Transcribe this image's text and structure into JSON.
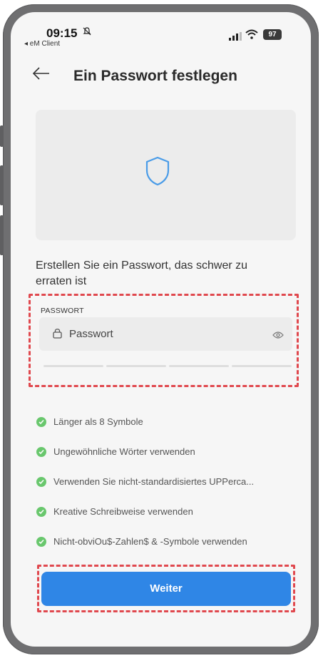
{
  "status_bar": {
    "time": "09:15",
    "back_to_app": "◂ eM Client",
    "battery": "97"
  },
  "header": {
    "title": "Ein Passwort festlegen"
  },
  "intro": {
    "text": "Erstellen Sie ein Passwort, das schwer zu erraten ist"
  },
  "password": {
    "label": "PASSWORT",
    "placeholder": "Passwort"
  },
  "requirements": [
    {
      "text": "Länger als 8 Symbole"
    },
    {
      "text": "Ungewöhnliche Wörter verwenden"
    },
    {
      "text": "Verwenden Sie nicht-standardisiertes UPPerca..."
    },
    {
      "text": "Kreative Schreibweise verwenden"
    },
    {
      "text": "Nicht-obviOu$-Zahlen$ & -Symbole verwenden"
    }
  ],
  "button": {
    "label": "Weiter"
  },
  "colors": {
    "accent": "#2f86e6",
    "check": "#69c76d",
    "highlight": "#e0484e"
  }
}
